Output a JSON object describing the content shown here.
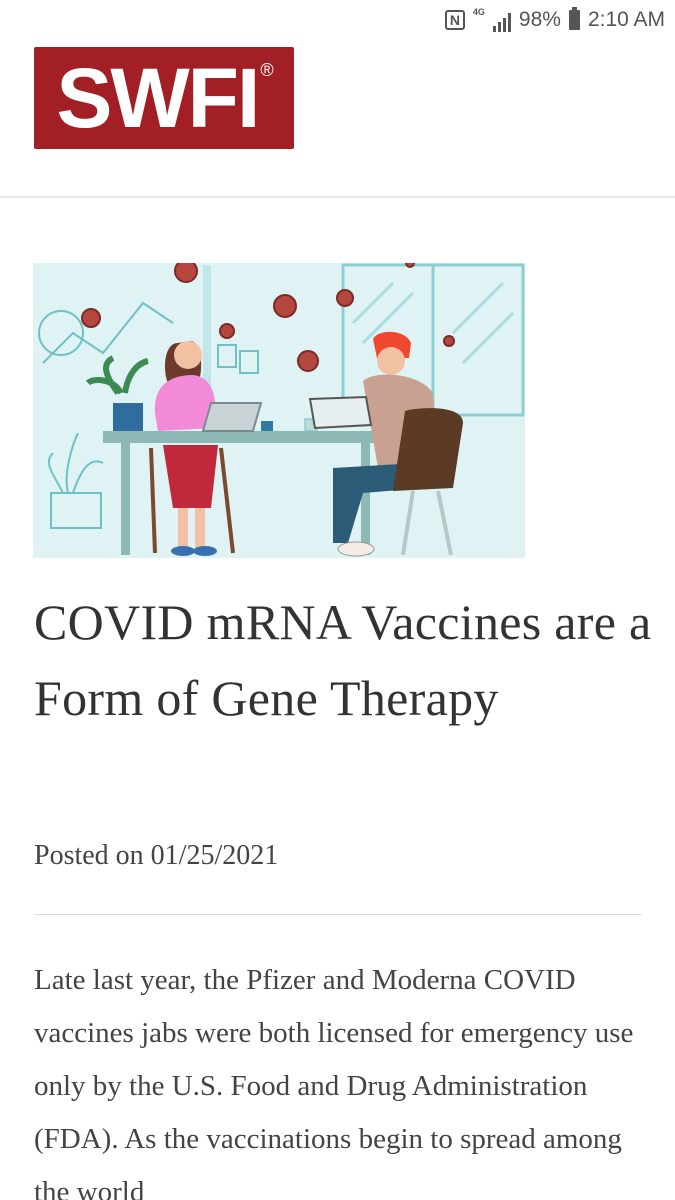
{
  "status_bar": {
    "nfc": "N",
    "network": "4G",
    "battery": "98%",
    "time": "2:10 AM"
  },
  "header": {
    "logo_text": "SWFI",
    "logo_mark": "®",
    "brand_color": "#a21f25"
  },
  "hero": {
    "icon": "illustration-two-people-at-table-with-virus-particles"
  },
  "article": {
    "title": "COVID mRNA Vaccines are a Form of Gene Therapy",
    "posted": "Posted on 01/25/2021",
    "body": "Late last year, the Pfizer and Moderna COVID vaccines jabs were both licensed for emergency use only by the U.S. Food and Drug Administration (FDA). As the vaccinations begin to spread among the world"
  }
}
